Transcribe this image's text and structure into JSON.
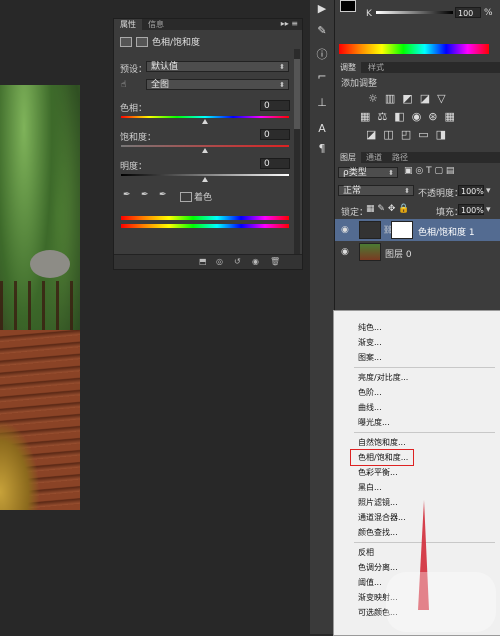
{
  "properties_panel": {
    "tabs": [
      "属性",
      "信息"
    ],
    "title": "色相/饱和度",
    "preset_label": "预设：",
    "preset_value": "默认值",
    "channel_value": "全图",
    "hue_label": "色相：",
    "hue_value": "0",
    "saturation_label": "饱和度：",
    "saturation_value": "0",
    "lightness_label": "明度：",
    "lightness_value": "0",
    "colorize_label": "着色"
  },
  "color_panel": {
    "k_label": "K",
    "k_value": "100",
    "percent": "%"
  },
  "adjustments_panel": {
    "tabs": [
      "调整",
      "样式"
    ],
    "add_label": "添加调整"
  },
  "layers_panel": {
    "tabs": [
      "图层",
      "通道",
      "路径"
    ],
    "filter_label": "ρ类型",
    "blend_mode": "正常",
    "opacity_label": "不透明度：",
    "opacity_value": "100%",
    "lock_label": "锁定：",
    "fill_label": "填充：",
    "fill_value": "100%",
    "layers": [
      {
        "name": "色相/饱和度 1",
        "selected": true
      },
      {
        "name": "图层 0",
        "selected": false
      }
    ]
  },
  "context_menu": {
    "groups": [
      [
        "纯色...",
        "渐变...",
        "图案..."
      ],
      [
        "亮度/对比度...",
        "色阶...",
        "曲线...",
        "曝光度..."
      ],
      [
        "自然饱和度...",
        "色相/饱和度...",
        "色彩平衡...",
        "黑白...",
        "照片滤镜...",
        "通道混合器...",
        "颜色查找..."
      ],
      [
        "反相",
        "色调分离...",
        "阈值...",
        "渐变映射...",
        "可选颜色..."
      ]
    ],
    "highlighted_item": "色相/饱和度..."
  },
  "colors": {
    "panel_bg": "#3c3c3c",
    "selected_layer": "#536b91",
    "highlight_box": "#dd2222"
  }
}
